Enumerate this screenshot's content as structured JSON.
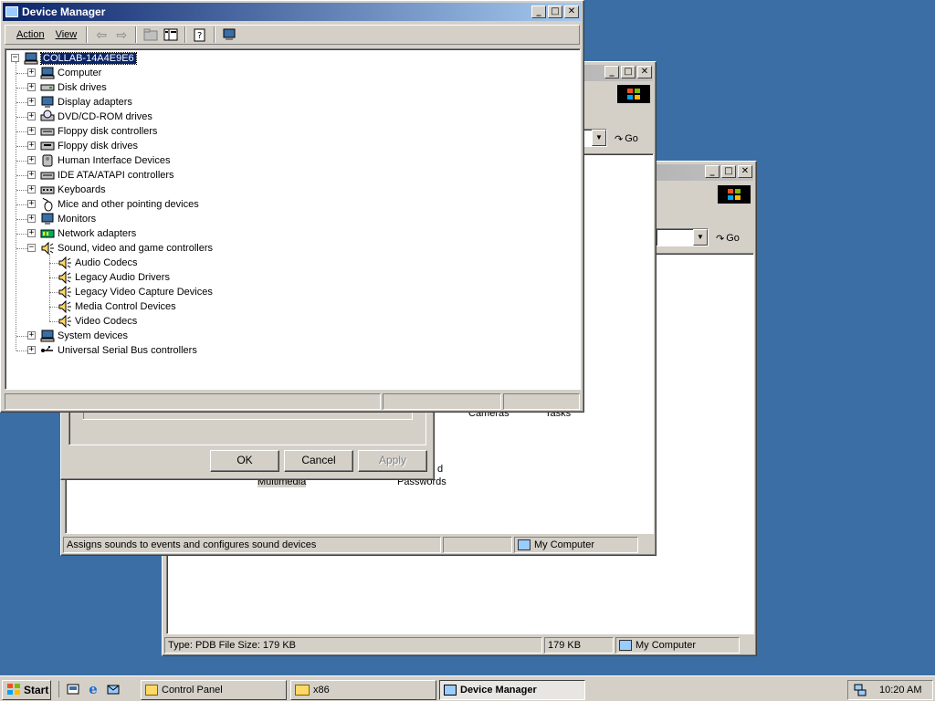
{
  "back_window2": {
    "go_label": "Go",
    "status": {
      "type_text": "Type: PDB File Size: 179 KB",
      "size": "179 KB",
      "zone": "My Computer"
    }
  },
  "back_window1": {
    "go_label": "Go",
    "status": {
      "text": "Assigns sounds to events and configures sound devices",
      "zone": "My Computer"
    },
    "visible_items": [
      "Cameras",
      "Tasks",
      "d",
      "Multimedia",
      "Passwords"
    ]
  },
  "dialog": {
    "ok_label": "OK",
    "cancel_label": "Cancel",
    "apply_label": "Apply"
  },
  "device_manager": {
    "title": "Device Manager",
    "menu": {
      "action": "Action",
      "view": "View"
    },
    "tree": {
      "root": "COLLAB-14A4E9E6",
      "items": [
        {
          "label": "Computer",
          "icon": "computer-icon"
        },
        {
          "label": "Disk drives",
          "icon": "disk-drive-icon"
        },
        {
          "label": "Display adapters",
          "icon": "display-adapter-icon"
        },
        {
          "label": "DVD/CD-ROM drives",
          "icon": "cdrom-icon"
        },
        {
          "label": "Floppy disk controllers",
          "icon": "controller-icon"
        },
        {
          "label": "Floppy disk drives",
          "icon": "floppy-icon"
        },
        {
          "label": "Human Interface Devices",
          "icon": "hid-icon"
        },
        {
          "label": "IDE ATA/ATAPI controllers",
          "icon": "controller-icon"
        },
        {
          "label": "Keyboards",
          "icon": "keyboard-icon"
        },
        {
          "label": "Mice and other pointing devices",
          "icon": "mouse-icon"
        },
        {
          "label": "Monitors",
          "icon": "monitor-icon"
        },
        {
          "label": "Network adapters",
          "icon": "network-icon"
        },
        {
          "label": "Sound, video and game controllers",
          "icon": "speaker-icon",
          "expanded": true
        },
        {
          "label": "System devices",
          "icon": "computer-icon"
        },
        {
          "label": "Universal Serial Bus controllers",
          "icon": "usb-icon"
        }
      ],
      "sound_children": [
        "Audio Codecs",
        "Legacy Audio Drivers",
        "Legacy Video Capture Devices",
        "Media Control Devices",
        "Video Codecs"
      ]
    }
  },
  "taskbar": {
    "start_label": "Start",
    "tasks": [
      "Control Panel",
      "x86",
      "Device Manager"
    ],
    "clock": "10:20 AM"
  }
}
